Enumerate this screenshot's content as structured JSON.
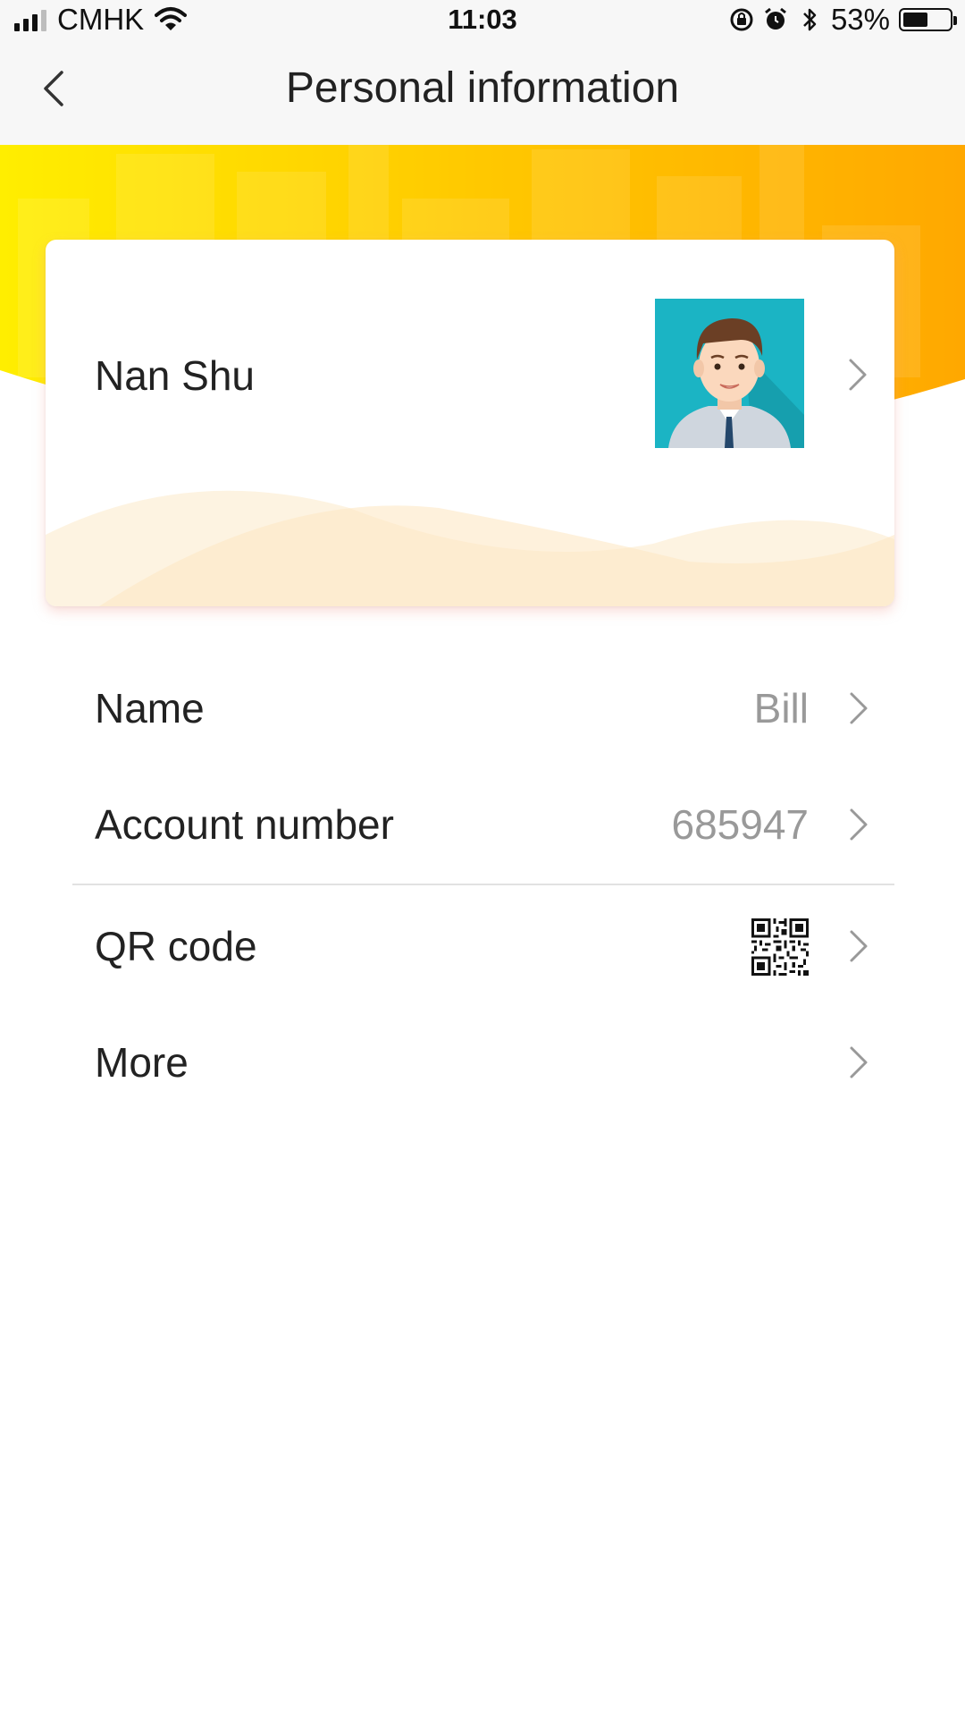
{
  "status_bar": {
    "carrier": "CMHK",
    "time": "11:03",
    "battery_percent": "53%",
    "battery_level": 0.53,
    "icons": [
      "signal-icon",
      "wifi-icon",
      "rotation-lock-icon",
      "alarm-icon",
      "bluetooth-icon",
      "battery-icon"
    ]
  },
  "nav": {
    "title": "Personal information",
    "back_icon": "chevron-left-icon"
  },
  "profile_card": {
    "display_name": "Nan Shu",
    "avatar": "avatar-man-icon",
    "chevron_icon": "chevron-right-icon"
  },
  "list": {
    "name_label": "Name",
    "name_value": "Bill",
    "account_label": "Account number",
    "account_value": "685947",
    "qr_label": "QR code",
    "qr_icon": "qr-code-icon",
    "more_label": "More"
  },
  "colors": {
    "banner_start": "#ffe800",
    "banner_end": "#ffae00",
    "avatar_bg": "#1bb4c4",
    "text_primary": "#222222",
    "text_secondary": "#999999"
  }
}
